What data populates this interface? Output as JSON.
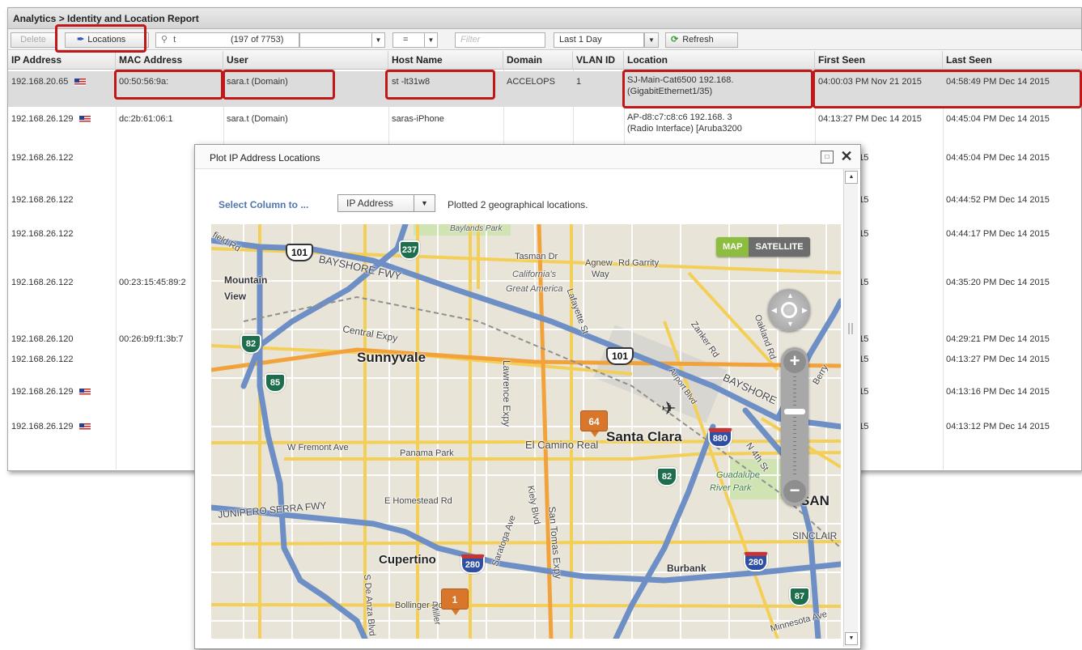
{
  "report": {
    "title": "Analytics > Identity and Location Report",
    "toolbar": {
      "delete_label": "Delete",
      "locations_label": "Locations",
      "search_value": "t",
      "count_text": "(197 of 7753)",
      "operator_value": "=",
      "filter_placeholder": "Filter",
      "range_value": "Last 1 Day",
      "refresh_label": "Refresh"
    },
    "columns": [
      "IP Address",
      "MAC Address",
      "User",
      "Host Name",
      "Domain",
      "VLAN ID",
      "Location",
      "First Seen",
      "Last Seen"
    ],
    "rows": [
      {
        "ip": "192.168.20.65",
        "flag": true,
        "mac": "00:50:56:9a:",
        "user": "sara.t       (Domain)",
        "host": "st        -lt31w8",
        "domain": "ACCELOPS",
        "vlan": "1",
        "location": "SJ-Main-Cat6500 192.168.",
        "location2": "(GigabitEthernet1/35)",
        "first": "04:00:03 PM Nov 21 2015",
        "last": "04:58:49 PM Dec 14 2015"
      },
      {
        "ip": "192.168.26.129",
        "flag": true,
        "mac": "dc:2b:61:06:1",
        "user": "sara.t        (Domain)",
        "host": "saras-iPhone",
        "domain": "",
        "vlan": "",
        "location": "AP-d8:c7:c8:c6     192.168.      3",
        "location2": "(Radio Interface)  [Aruba3200",
        "first": "04:13:27 PM Dec 14 2015",
        "last": "04:45:04 PM Dec 14 2015"
      },
      {
        "ip": "192.168.26.122",
        "flag": false,
        "mac": "",
        "user": "",
        "host": "",
        "domain": "",
        "vlan": "",
        "location": "",
        "location2": "",
        "first": "Dec 14 2015",
        "last": "04:45:04 PM Dec 14 2015"
      },
      {
        "ip": "192.168.26.122",
        "flag": false,
        "mac": "",
        "user": "",
        "host": "",
        "domain": "",
        "vlan": "",
        "location": "",
        "location2": "",
        "first": "Dec 14 2015",
        "last": "04:44:52 PM Dec 14 2015"
      },
      {
        "ip": "192.168.26.122",
        "flag": false,
        "mac": "",
        "user": "",
        "host": "",
        "domain": "",
        "vlan": "",
        "location": "",
        "location2": "",
        "first": "Dec 14 2015",
        "last": "04:44:17 PM Dec 14 2015"
      },
      {
        "ip": "192.168.26.122",
        "flag": false,
        "mac": "00:23:15:45:89:2",
        "user": "",
        "host": "",
        "domain": "",
        "vlan": "",
        "location": "",
        "location2": "",
        "first": "Dec 14 2015",
        "last": "04:35:20 PM Dec 14 2015"
      },
      {
        "ip": "192.168.26.120",
        "flag": false,
        "mac": "00:26:b9:f1:3b:7",
        "user": "",
        "host": "",
        "domain": "",
        "vlan": "",
        "location": "",
        "location2": "",
        "first": "Nov 21 2015",
        "last": "04:29:21 PM Dec 14 2015"
      },
      {
        "ip": "192.168.26.122",
        "flag": false,
        "mac": "",
        "user": "",
        "host": "",
        "domain": "",
        "vlan": "",
        "location": "",
        "location2": "",
        "first": "Dec 14 2015",
        "last": "04:13:27 PM Dec 14 2015"
      },
      {
        "ip": "192.168.26.129",
        "flag": true,
        "mac": "",
        "user": "",
        "host": "",
        "domain": "",
        "vlan": "",
        "location": "",
        "location2": "",
        "first": "Dec 14 2015",
        "last": "04:13:16 PM Dec 14 2015"
      },
      {
        "ip": "192.168.26.129",
        "flag": true,
        "mac": "",
        "user": "",
        "host": "",
        "domain": "",
        "vlan": "",
        "location": "",
        "location2": "",
        "first": "Dec 14 2015",
        "last": "04:13:12 PM Dec 14 2015"
      }
    ]
  },
  "dialog": {
    "title": "Plot IP Address Locations",
    "select_label": "Select Column to ...",
    "select_value": "IP Address",
    "status": "Plotted 2 geographical locations.",
    "map": {
      "type_map": "MAP",
      "type_satellite": "SATELLITE",
      "markers": [
        "64",
        "1"
      ],
      "places": {
        "mountain_view_1": "Mountain",
        "mountain_view_2": "View",
        "sunnyvale": "Sunnyvale",
        "santa_clara": "Santa Clara",
        "cupertino": "Cupertino",
        "burbank": "Burbank",
        "san": "SAN",
        "guadalupe": "Guadalupe",
        "river_park": "River Park",
        "californias": "California's",
        "great_america": "Great America",
        "agnew": "Agnew",
        "garrity": "Rd Garrity",
        "way": "Way",
        "baylands": "Baylands Park"
      },
      "roads": {
        "bayshore": "BAYSHORE FWY",
        "bayshore_e": "BAYSHORE",
        "central": "Central Expy",
        "lawrence": "Lawrence Expy",
        "el_camino": "El Camino Real",
        "w_fremont": "W Fremont Ave",
        "panama": "Panama Park",
        "e_homestead": "E Homestead Rd",
        "junipero": "JUNIPERO SERRA FWY",
        "tasman": "Tasman Dr",
        "lafayette": "Lafayette St",
        "zanker": "Zanker Rd",
        "airport": "Airport Blvd",
        "n_4th": "N 4th St",
        "oakland": "Oakland Rd",
        "kiely": "Kiely Blvd",
        "san_tomas": "San Tomas Expy",
        "saratoga": "Saratoga Ave",
        "de_anza": "S De Anza Blvd",
        "bollinger": "Bollinger Rd",
        "sinclair": "SINCLAIR",
        "minnesota": "Minnesota Ave",
        "miller": "Miller",
        "berry": "Berry",
        "field": "field Rd"
      },
      "shields": {
        "us101a": "101",
        "us101b": "101",
        "ca237": "237",
        "ca82a": "82",
        "ca85": "85",
        "ca82b": "82",
        "i880": "880",
        "i280a": "280",
        "i280b": "280",
        "ca87": "87"
      }
    }
  }
}
